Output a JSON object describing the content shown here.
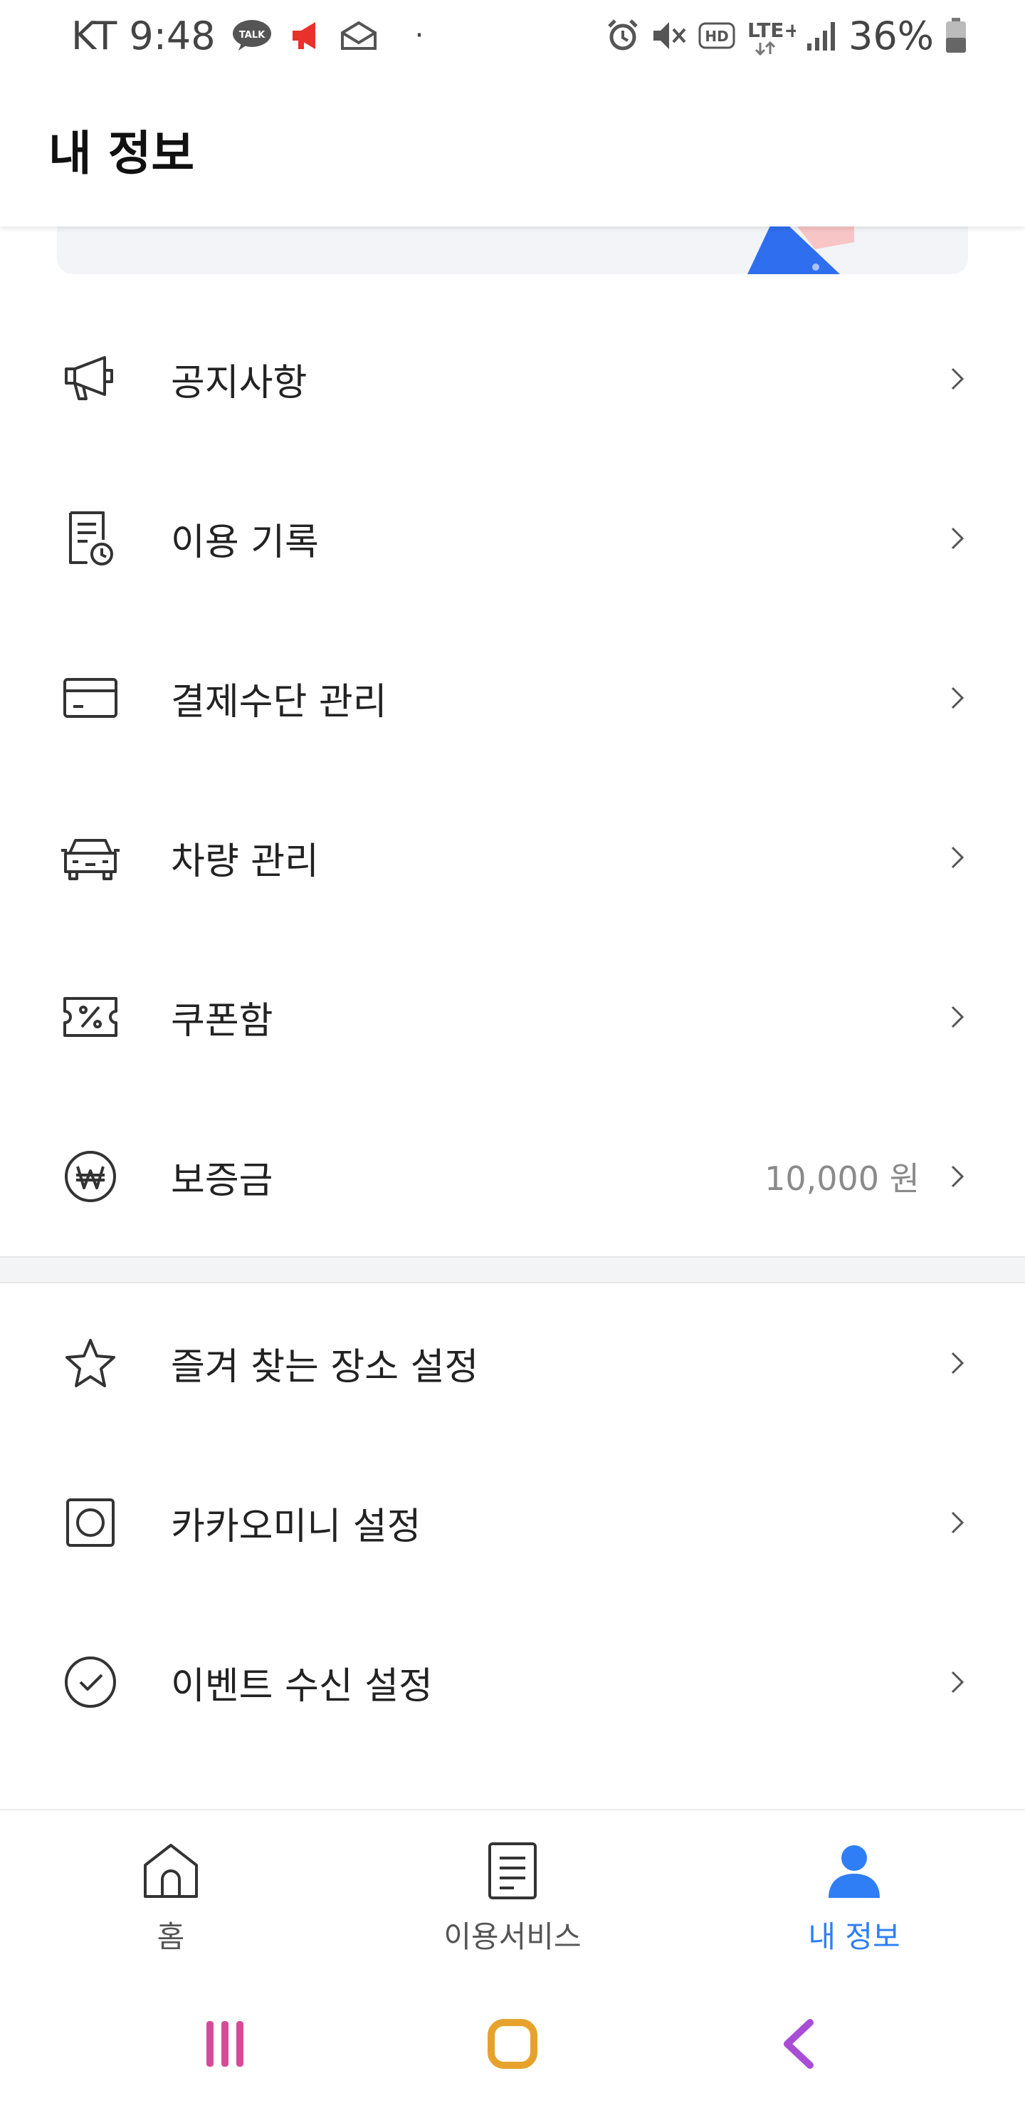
{
  "status_bar": {
    "carrier_time": "KT 9:48",
    "talk_badge": "TALK",
    "dot": "·",
    "network": "LTE+",
    "hd": "HD",
    "battery": "36%"
  },
  "header": {
    "title": "내 정보"
  },
  "menu": {
    "items": [
      {
        "label": "공지사항",
        "icon": "megaphone-icon"
      },
      {
        "label": "이용 기록",
        "icon": "receipt-clock-icon"
      },
      {
        "label": "결제수단 관리",
        "icon": "credit-card-icon"
      },
      {
        "label": "차량 관리",
        "icon": "car-icon"
      },
      {
        "label": "쿠폰함",
        "icon": "coupon-icon"
      },
      {
        "label": "보증금",
        "icon": "won-coin-icon",
        "value": "10,000 원"
      }
    ],
    "settings": [
      {
        "label": "즐겨 찾는 장소 설정",
        "icon": "star-icon"
      },
      {
        "label": "카카오미니 설정",
        "icon": "speaker-icon"
      },
      {
        "label": "이벤트 수신 설정",
        "icon": "check-circle-icon"
      }
    ]
  },
  "bottom_nav": {
    "home": "홈",
    "services": "이용서비스",
    "my_info": "내 정보"
  },
  "colors": {
    "accent": "#2f7ef5",
    "text": "#222222",
    "muted": "#8a8a8a"
  }
}
